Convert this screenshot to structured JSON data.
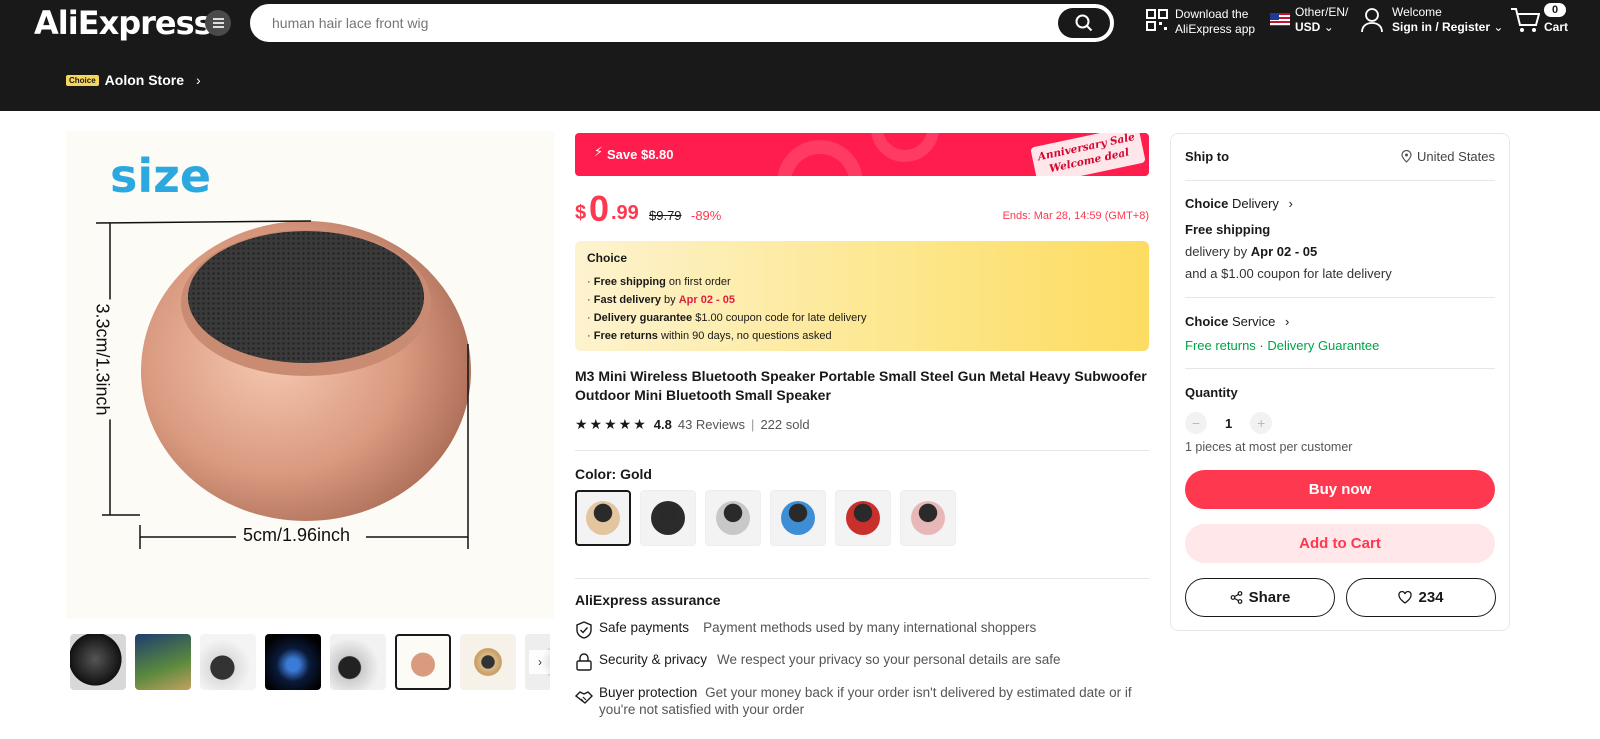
{
  "header": {
    "logo": "AliExpress",
    "search_placeholder": "human hair lace front wig",
    "download_line1": "Download the",
    "download_line2": "AliExpress app",
    "region_line1": "Other/EN/",
    "region_line2": "USD",
    "account_line1": "Welcome",
    "account_line2": "Sign in / Register",
    "cart_count": "0",
    "cart_label": "Cart"
  },
  "store": {
    "badge": "Choice",
    "name": "Aolon Store"
  },
  "gallery": {
    "size_label": "size",
    "height_label": "3.3cm/1.3inch",
    "width_label": "5cm/1.96inch"
  },
  "promo": {
    "save_text": "Save $8.80",
    "tag_line1": "Anniversary Sale",
    "tag_line2": "Welcome deal"
  },
  "price": {
    "currency": "$",
    "integer": "0",
    "decimal": ".99",
    "original": "$9.79",
    "discount": "-89%",
    "ends": "Ends: Mar 28, 14:59 (GMT+8)"
  },
  "choice_box": {
    "title": "Choice",
    "lines": [
      {
        "bold": "Free shipping",
        "rest": " on first order"
      },
      {
        "bold": "Fast delivery",
        "mid": " by ",
        "red": "Apr 02 - 05"
      },
      {
        "bold": "Delivery guarantee",
        "rest": "  $1.00 coupon code for late delivery"
      },
      {
        "bold": "Free returns",
        "rest": "  within 90 days, no questions asked"
      }
    ]
  },
  "product": {
    "title": "M3 Mini Wireless Bluetooth Speaker Portable Small Steel Gun Metal Heavy Subwoofer Outdoor Mini Bluetooth Small Speaker",
    "rating": "4.8",
    "reviews": "43 Reviews",
    "sold": "222 sold",
    "color_label": "Color: Gold",
    "colors": [
      "#e3c6a0",
      "#2b2b2b",
      "#c8c8c8",
      "#3e8ed6",
      "#c9302c",
      "#e8b8b8"
    ]
  },
  "assurance": {
    "title": "AliExpress assurance",
    "items": [
      {
        "label": "Safe payments",
        "desc": "Payment methods used by many international shoppers"
      },
      {
        "label": "Security & privacy",
        "desc": "We respect your privacy so your personal details are safe"
      },
      {
        "label": "Buyer protection",
        "desc": "Get your money back if your order isn't delivered by estimated date or if you're not satisfied with your order"
      }
    ]
  },
  "panel": {
    "ship_to": "Ship to",
    "country": "United States",
    "delivery_title_bold": "Choice",
    "delivery_title": " Delivery",
    "free_shipping": "Free shipping",
    "delivery_prefix": "delivery by ",
    "delivery_dates": "Apr 02 - 05",
    "late_coupon": "and a $1.00 coupon for late delivery",
    "service_title_bold": "Choice",
    "service_title": " Service",
    "free_returns": "Free returns",
    "service_dot": " · ",
    "delivery_guarantee": "Delivery Guarantee",
    "quantity_label": "Quantity",
    "quantity_value": "1",
    "quantity_limit": "1 pieces at most per customer",
    "buy_now": "Buy now",
    "add_to_cart": "Add to Cart",
    "share": "Share",
    "wishlist_count": "234"
  }
}
